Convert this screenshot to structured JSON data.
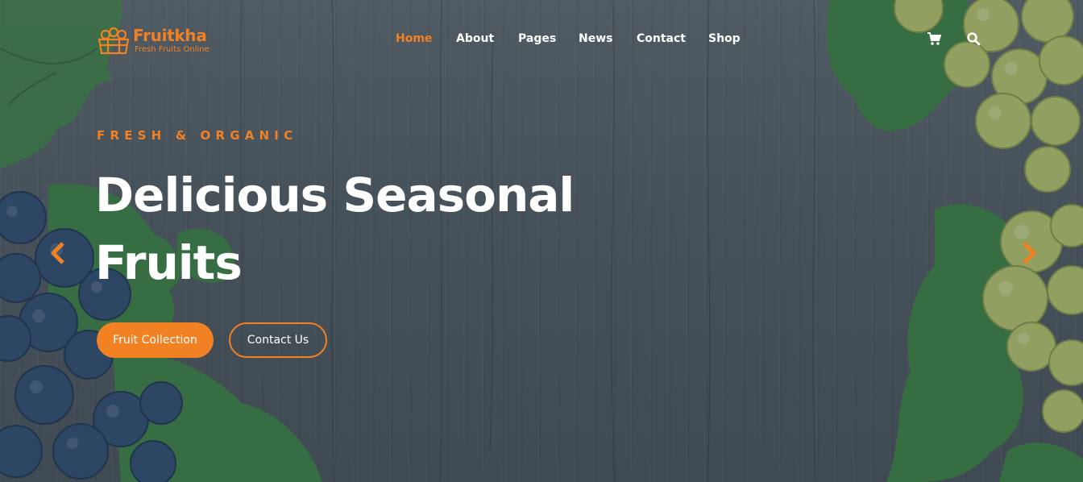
{
  "brand": {
    "name": "Fruitkha",
    "tagline": "Fresh Fruits Online",
    "accent_color": "#f28123"
  },
  "nav": {
    "items": [
      {
        "label": "Home",
        "active": true
      },
      {
        "label": "About",
        "active": false
      },
      {
        "label": "Pages",
        "active": false
      },
      {
        "label": "News",
        "active": false
      },
      {
        "label": "Contact",
        "active": false
      },
      {
        "label": "Shop",
        "active": false
      }
    ]
  },
  "header_icons": [
    "cart-icon",
    "search-icon"
  ],
  "hero": {
    "subtitle": "FRESH & ORGANIC",
    "title_line1": "Delicious Seasonal",
    "title_line2": "Fruits",
    "primary_button": "Fruit Collection",
    "secondary_button": "Contact Us"
  },
  "slider": {
    "prev_icon": "chevron-left-icon",
    "next_icon": "chevron-right-icon"
  }
}
